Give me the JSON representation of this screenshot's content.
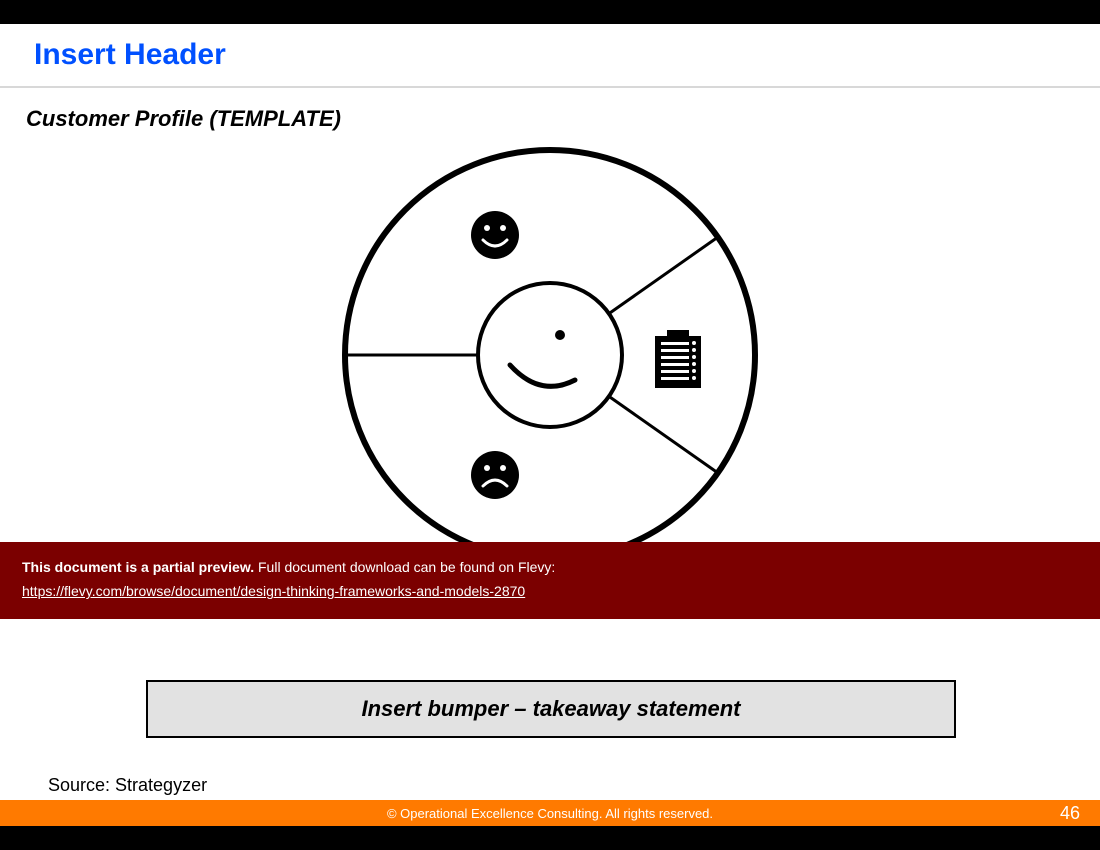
{
  "header": {
    "title": "Insert Header"
  },
  "subtitle": "Customer Profile (TEMPLATE)",
  "diagram": {
    "icons": {
      "gains": "smile-face-icon",
      "pains": "frown-face-icon",
      "jobs": "checklist-icon",
      "center": "profile-face-icon"
    }
  },
  "preview_banner": {
    "line1_bold": "This document is a partial preview.",
    "line1_rest": "  Full document download can be found on Flevy:",
    "line2": "https://flevy.com/browse/document/design-thinking-frameworks-and-models-2870"
  },
  "bumper": "Insert bumper – takeaway statement",
  "source": "Source: Strategyzer",
  "footer": {
    "copyright": "© Operational Excellence Consulting.  All rights reserved.",
    "page_number": "46"
  },
  "colors": {
    "header_blue": "#0050ff",
    "footer_orange": "#ff7a00",
    "banner_maroon": "#7b0000",
    "bumper_grey": "#e2e2e2"
  }
}
